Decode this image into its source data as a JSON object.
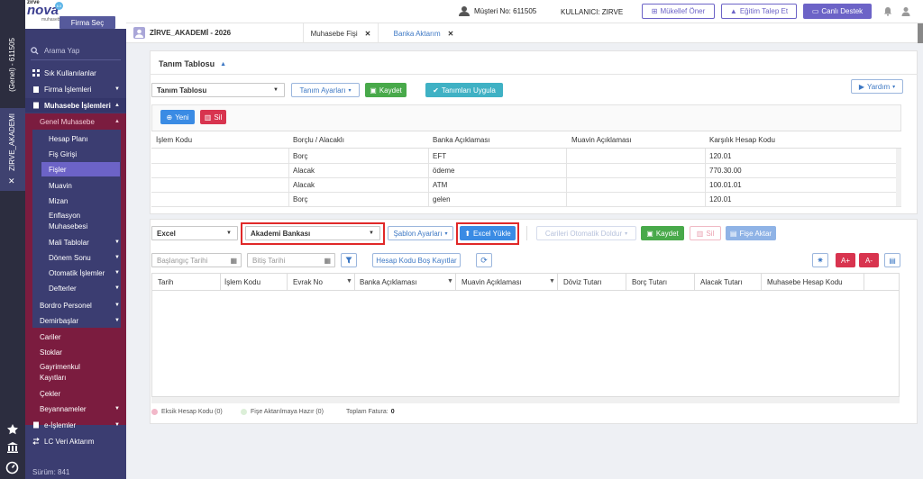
{
  "brand": {
    "top": "zirve",
    "name": "nova",
    "sub": "muhasebe",
    "badge": "6.0"
  },
  "vstrip": {
    "label1": "(Genel) - 611505",
    "label2": "ZIRVE_AKADEMI"
  },
  "sidebar": {
    "firma_sec": "Firma Seç",
    "search_placeholder": "Arama Yap",
    "items": [
      {
        "label": "Sık Kullanılanlar"
      },
      {
        "label": "Firma İşlemleri"
      },
      {
        "label": "Muhasebe İşlemleri"
      },
      {
        "label": "Genel Muhasebe"
      },
      {
        "label": "Hesap Planı"
      },
      {
        "label": "Fiş Girişi"
      },
      {
        "label": "Fişler"
      },
      {
        "label": "Muavin"
      },
      {
        "label": "Mizan"
      },
      {
        "label": "Enflasyon"
      },
      {
        "label": "Muhasebesi"
      },
      {
        "label": "Mali Tablolar"
      },
      {
        "label": "Dönem Sonu"
      },
      {
        "label": "Otomatik İşlemler"
      },
      {
        "label": "Defterler"
      },
      {
        "label": "Bordro Personel"
      },
      {
        "label": "Demirbaşlar"
      },
      {
        "label": "Cariler"
      },
      {
        "label": "Stoklar"
      },
      {
        "label": "Gayrimenkul"
      },
      {
        "label": "Kayıtları"
      },
      {
        "label": "Çekler"
      },
      {
        "label": "Beyannameler"
      },
      {
        "label": "e-İşlemler"
      },
      {
        "label": "LC Veri Aktarım"
      }
    ],
    "version": "Sürüm: 841"
  },
  "topbar": {
    "musteri": "Müşteri No: 611505",
    "kullanici": "KULLANICI: ZIRVE",
    "btn1": "Mükellef Öner",
    "btn2": "Eğitim Talep Et",
    "btn3": "Canlı Destek"
  },
  "tabs": {
    "company": "ZİRVE_AKADEMİ - 2026",
    "tab1": "Muhasebe Fişi",
    "tab2": "Banka Aktarım"
  },
  "top_panel": {
    "title": "Tanım Tablosu",
    "select_value": "Tanım Tablosu",
    "tanim_ayarlari": "Tanım Ayarları",
    "kaydet": "Kaydet",
    "tanimlari_uygula": "Tanımları Uygula",
    "yardim": "Yardım",
    "yeni": "Yeni",
    "sil": "Sil",
    "columns": [
      "İşlem Kodu",
      "Borçlu / Alacaklı",
      "Banka Açıklaması",
      "Muavin Açıklaması",
      "Karşılık Hesap Kodu"
    ],
    "rows": [
      [
        "",
        "Borç",
        "EFT",
        "",
        "120.01"
      ],
      [
        "",
        "Alacak",
        "ödeme",
        "",
        "770.30.00"
      ],
      [
        "",
        "Alacak",
        "ATM",
        "",
        "100.01.01"
      ],
      [
        "",
        "Borç",
        "gelen",
        "",
        "120.01"
      ]
    ]
  },
  "bottom_panel": {
    "format_value": "Excel",
    "bank_value": "Akademi Bankası",
    "sablon_ayarlari": "Şablon Ayarları",
    "excel_yukle": "Excel Yükle",
    "carileri_doldur": "Carileri Otomatik Doldur",
    "kaydet": "Kaydet",
    "sil": "Sil",
    "fise_aktar": "Fişe Aktar",
    "baslangic_placeholder": "Başlangıç Tarihi",
    "bitis_placeholder": "Bitiş Tarihi",
    "hesap_kodu_bos": "Hesap Kodu Boş Kayıtlar",
    "font_up": "A+",
    "font_down": "A-",
    "columns": [
      "Tarih",
      "İşlem Kodu",
      "Evrak No",
      "Banka Açıklaması",
      "Muavin Açıklaması",
      "Döviz Tutarı",
      "Borç Tutarı",
      "Alacak Tutarı",
      "Muhasebe Hesap Kodu"
    ],
    "footer": {
      "eksik": "Eksik Hesap Kodu (0)",
      "hazir": "Fişe Aktarılmaya Hazır (0)",
      "toplam_label": "Toplam Fatura:",
      "toplam_value": "0"
    }
  },
  "colors": {
    "sidebar": "#3b3d71",
    "active": "#6c63c7",
    "accent": "#3a8be4",
    "highlight": "#e02828"
  }
}
